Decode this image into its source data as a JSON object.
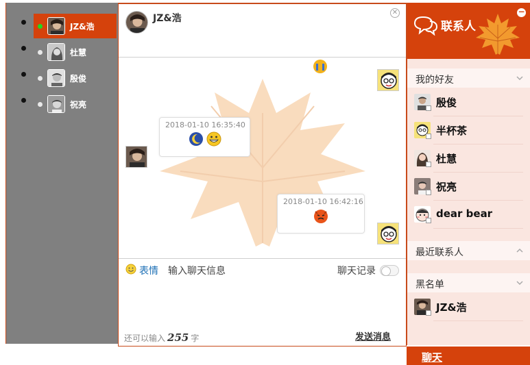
{
  "sessions": [
    {
      "name": "JZ&浩",
      "active": true
    },
    {
      "name": "杜慧",
      "active": false
    },
    {
      "name": "殷俊",
      "active": false
    },
    {
      "name": "祝亮",
      "active": false
    }
  ],
  "chat": {
    "title": "JZ&浩",
    "close_icon": "close-circle-icon",
    "messages": [
      {
        "time": "2018-01-10 16:35:40"
      },
      {
        "time": "2018-01-10 16:42:16"
      }
    ],
    "toolbar": {
      "emoji_label": "表情",
      "input_placeholder": "输入聊天信息",
      "history_label": "聊天记录"
    },
    "counter_prefix": "还可以输入",
    "counter_value": "255",
    "counter_suffix": "字",
    "send_label": "发送消息"
  },
  "contacts": {
    "title": "联系人",
    "groups": {
      "friends": {
        "label": "我的好友",
        "members": [
          "殷俊",
          "半杯茶",
          "杜慧",
          "祝亮",
          "dear bear"
        ]
      },
      "recent": {
        "label": "最近联系人"
      },
      "blacklist": {
        "label": "黑名单",
        "members": [
          "JZ&浩"
        ]
      }
    },
    "bottom_tab": "聊天"
  },
  "colors": {
    "accent": "#d5420c",
    "link": "#1c6fb5",
    "online": "#1fd91f"
  }
}
